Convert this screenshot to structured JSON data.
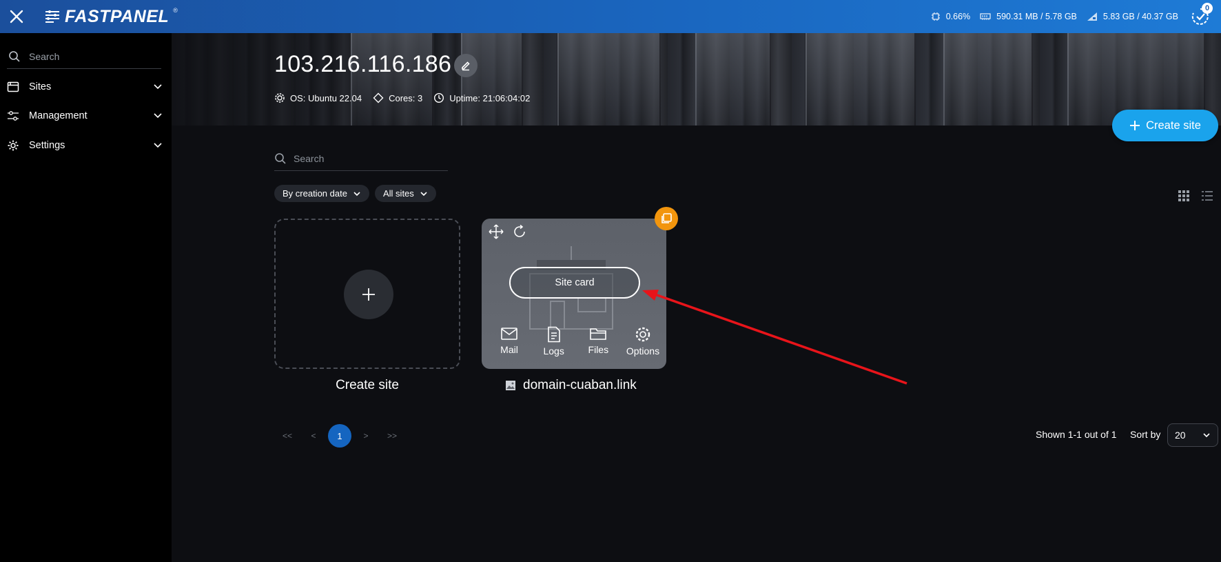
{
  "topbar": {
    "logo_text": "FASTPANEL",
    "logo_mark": "®",
    "stats": {
      "cpu": "0.66%",
      "ram": "590.31 MB / 5.78 GB",
      "disk": "5.83 GB / 40.37 GB"
    },
    "notifications_count": "0"
  },
  "sidebar": {
    "search_placeholder": "Search",
    "items": [
      {
        "label": "Sites",
        "icon": "browser-window-icon"
      },
      {
        "label": "Management",
        "icon": "sliders-icon"
      },
      {
        "label": "Settings",
        "icon": "gear-icon"
      }
    ]
  },
  "server": {
    "ip": "103.216.116.186",
    "os": "OS: Ubuntu 22.04",
    "cores": "Cores: 3",
    "uptime": "Uptime: 21:06:04:02"
  },
  "actions": {
    "create_site_label": "Create site"
  },
  "main": {
    "search_placeholder": "Search",
    "filters": {
      "sort": "By creation date",
      "scope": "All sites"
    },
    "create_card_label": "Create site",
    "site": {
      "name": "domain-cuaban.link",
      "card_button": "Site card",
      "actions": [
        "Mail",
        "Logs",
        "Files",
        "Options"
      ]
    }
  },
  "pagination": {
    "first": "<<",
    "prev": "<",
    "current": "1",
    "next": ">",
    "last": ">>",
    "shown": "Shown 1-1 out of 1",
    "sort_by_label": "Sort by",
    "per_page": "20"
  },
  "colors": {
    "accent": "#1aa3ec",
    "topbar": "#1a66bf",
    "badge": "#f2950d",
    "annotation": "#e8141a"
  }
}
